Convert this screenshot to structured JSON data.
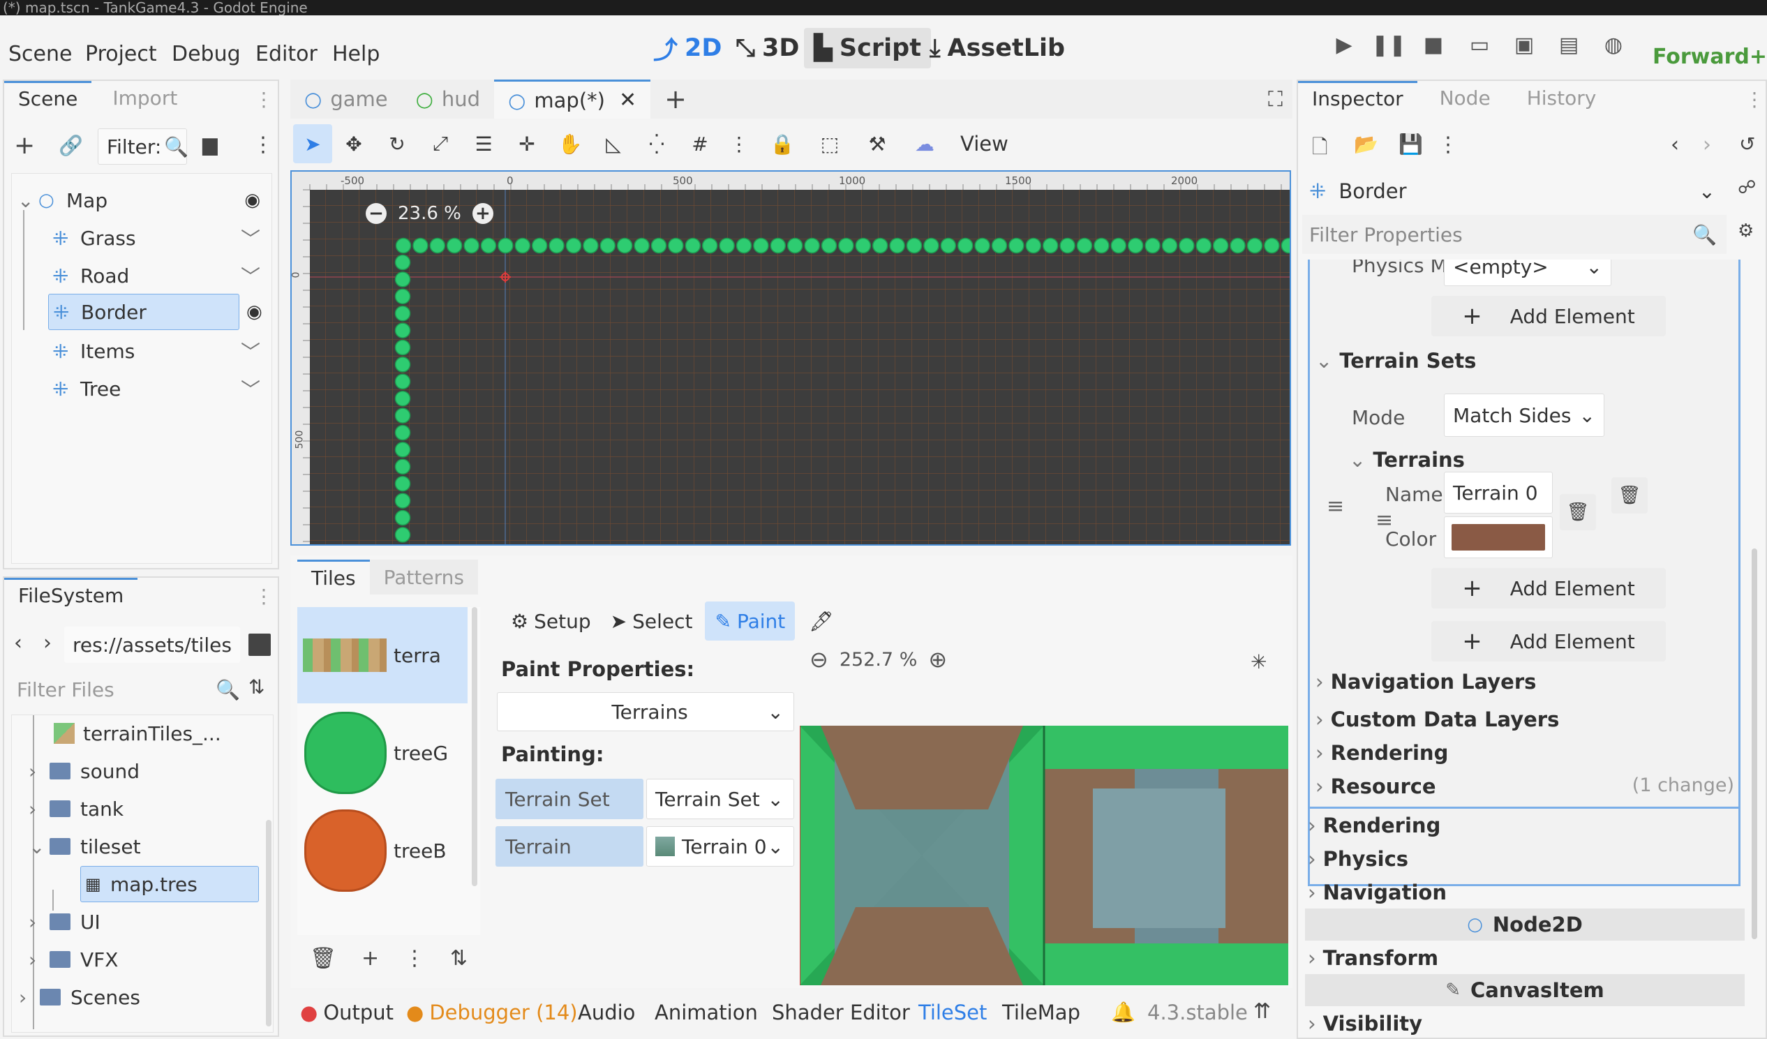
{
  "window": {
    "title": "(*) map.tscn - TankGame4.3 - Godot Engine"
  },
  "menu": [
    "Scene",
    "Project",
    "Debug",
    "Editor",
    "Help"
  ],
  "workspaces": {
    "two_d": "2D",
    "three_d": "3D",
    "script": "Script",
    "assetlib": "AssetLib"
  },
  "renderer": "Forward+",
  "scene_dock": {
    "tabs": [
      "Scene",
      "Import"
    ],
    "filter_label": "Filter:",
    "nodes": [
      {
        "label": "Map",
        "icon": "node2d-icon",
        "visibility": "eye-icon"
      },
      {
        "label": "Grass",
        "icon": "tilemap-layer-icon",
        "visibility": "eye-closed-icon"
      },
      {
        "label": "Road",
        "icon": "tilemap-layer-icon",
        "visibility": "eye-closed-icon"
      },
      {
        "label": "Border",
        "icon": "tilemap-layer-icon",
        "visibility": "eye-icon"
      },
      {
        "label": "Items",
        "icon": "tilemap-layer-icon",
        "visibility": "eye-closed-icon"
      },
      {
        "label": "Tree",
        "icon": "tilemap-layer-icon",
        "visibility": "eye-closed-icon"
      }
    ]
  },
  "filesystem_dock": {
    "tab": "FileSystem",
    "path": "res://assets/tiles",
    "filter_placeholder": "Filter Files",
    "items": [
      {
        "label": "terrainTiles_...",
        "type": "image"
      },
      {
        "label": "sound",
        "type": "folder"
      },
      {
        "label": "tank",
        "type": "folder"
      },
      {
        "label": "tileset",
        "type": "folder"
      },
      {
        "label": "map.tres",
        "type": "tileset"
      },
      {
        "label": "UI",
        "type": "folder"
      },
      {
        "label": "VFX",
        "type": "folder"
      },
      {
        "label": "Scenes",
        "type": "folder"
      }
    ]
  },
  "scene_tabs": [
    {
      "label": "game"
    },
    {
      "label": "hud"
    },
    {
      "label": "map(*)"
    }
  ],
  "toolbar": {
    "view_label": "View"
  },
  "viewport": {
    "zoom": "23.6 %",
    "ruler_h_labels": [
      "-500",
      "0",
      "500",
      "1000",
      "1500",
      "2000"
    ],
    "ruler_v_labels": [
      "0",
      "500"
    ]
  },
  "tiles_panel": {
    "tabs": [
      "Tiles",
      "Patterns"
    ],
    "sources": [
      {
        "label": "terra",
        "color": "#c9a774"
      },
      {
        "label": "treeG",
        "color": "#2ebd5e"
      },
      {
        "label": "treeB",
        "color": "#d9622a"
      }
    ],
    "modes": {
      "setup": "Setup",
      "select": "Select",
      "paint": "Paint"
    },
    "paint_properties_label": "Paint Properties:",
    "paint_property_value": "Terrains",
    "painting_label": "Painting:",
    "terrain_set_label": "Terrain Set",
    "terrain_set_value": "Terrain Set",
    "terrain_label": "Terrain",
    "terrain_value": "Terrain 0",
    "atlas_zoom": "252.7 %"
  },
  "bottom_tabs": {
    "output": "Output",
    "debugger": "Debugger (14)",
    "audio": "Audio",
    "animation": "Animation",
    "shader_editor": "Shader Editor",
    "tileset": "TileSet",
    "tilemap": "TileMap",
    "version": "4.3.stable"
  },
  "inspector": {
    "tabs": [
      "Inspector",
      "Node",
      "History"
    ],
    "object_name": "Border",
    "filter_placeholder": "Filter Properties",
    "physics_material_label": "Physics Materia",
    "physics_material_value": "<empty>",
    "add_element": "Add Element",
    "terrain_sets_label": "Terrain Sets",
    "mode_label": "Mode",
    "mode_value": "Match Sides",
    "terrains_label": "Terrains",
    "name_label": "Name",
    "name_value": "Terrain 0",
    "color_label": "Color",
    "terrain_color": "#8a5a45",
    "sections": [
      "Navigation Layers",
      "Custom Data Layers",
      "Rendering",
      "Resource"
    ],
    "resource_change": "(1 change)",
    "outer_sections_1": [
      "Rendering",
      "Physics",
      "Navigation"
    ],
    "class_node2d": "Node2D",
    "transform": "Transform",
    "class_canvasitem": "CanvasItem",
    "visibility": "Visibility"
  },
  "colors": {
    "accent": "#4a90d9",
    "tile_green": "#2ecc71",
    "selection": "#cfe3fa"
  }
}
